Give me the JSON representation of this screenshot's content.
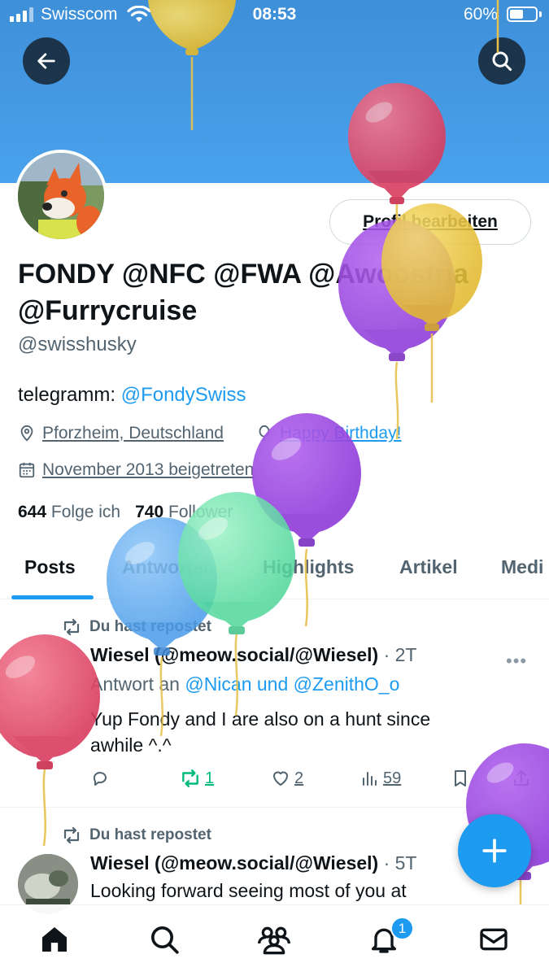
{
  "status_bar": {
    "carrier": "Swisscom",
    "time": "08:53",
    "battery": "60%",
    "battery_level": 0.6
  },
  "profile": {
    "display_name_line1": "FONDY @NFC @FWA @Awoostria",
    "display_name_line2": "@Furrycruise",
    "handle": "@swisshusky",
    "bio_prefix": "telegramm: ",
    "bio_link": "@FondySwiss",
    "location": "Pforzheim, Deutschland",
    "birthday": "Happy Birthday!",
    "joined": "November 2013 beigetreten",
    "following_count": "644",
    "following_label": "Folge ich",
    "followers_count": "740",
    "followers_label": "Follower",
    "edit_button": "Profil bearbeiten"
  },
  "tabs": [
    "Posts",
    "Antworten",
    "Highlights",
    "Artikel",
    "Medi"
  ],
  "posts": [
    {
      "repost_label": "Du hast repostet",
      "author": "Wiesel (@meow.social/@Wiesel)",
      "time": "· 2T",
      "reply_prefix": "Antwort an ",
      "reply_targets": "@Nican und @ZenithO_o",
      "text_line1": "Yup Fondy and I are also on a hunt since",
      "text_line2": "awhile ^.^",
      "more": "•••",
      "replies": "",
      "reposts": "1",
      "likes": "2",
      "views": "59"
    },
    {
      "repost_label": "Du hast repostet",
      "author": "Wiesel (@meow.social/@Wiesel)",
      "time": "· 5T",
      "text_line1": "Looking forward seeing most of you at"
    }
  ],
  "notifications_badge": "1",
  "colors": {
    "accent": "#1d9bf0",
    "repost_green": "#00ba7c",
    "banner": "#4aa2ec"
  },
  "icons": [
    "back-arrow-icon",
    "search-icon",
    "location-pin-icon",
    "balloon-icon",
    "calendar-icon",
    "repost-icon",
    "reply-icon",
    "heart-icon",
    "views-icon",
    "bookmark-icon",
    "share-icon",
    "plus-icon",
    "home-icon",
    "communities-icon",
    "bell-icon",
    "mail-icon"
  ]
}
